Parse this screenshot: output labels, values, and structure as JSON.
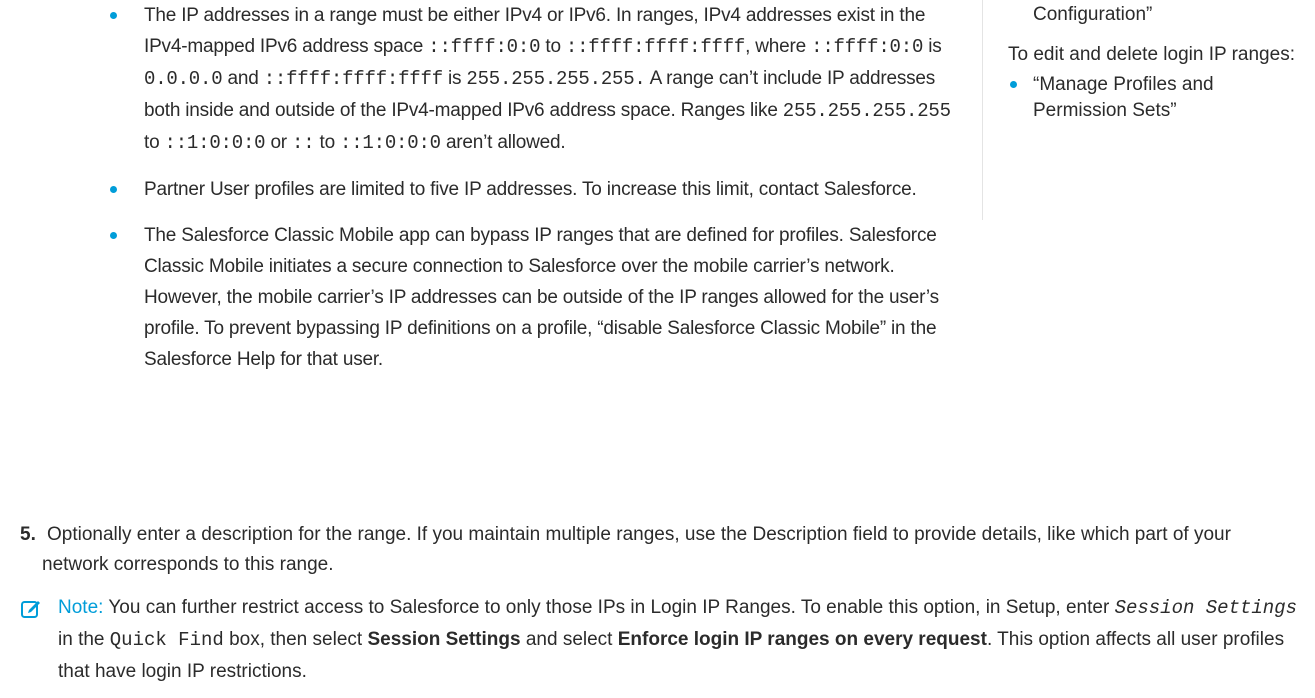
{
  "main_list": {
    "ip_family": {
      "t1": "The IP addresses in a range must be either IPv4 or IPv6. In ranges, IPv4 addresses exist in the IPv4-mapped IPv6 address space ",
      "c1": "::ffff:0:0",
      "t2": " to ",
      "c2": "::ffff:ffff:ffff",
      "t3": ", where ",
      "c3": "::ffff:0:0",
      "t4": " is ",
      "c4": "0.0.0.0",
      "t5": " and ",
      "c5": "::ffff:ffff:ffff",
      "t6": " is ",
      "c6": "255.255.255.255.",
      "t7": " A range can’t include IP addresses both inside and outside of the IPv4-mapped IPv6 address space. Ranges like ",
      "c7": "255.255.255.255",
      "t8": " to ",
      "c8": "::1:0:0:0",
      "t9": " or ",
      "c9": "::",
      "t10": " to ",
      "c10": "::1:0:0:0",
      "t11": " aren’t allowed."
    },
    "partner_limit": "Partner User profiles are limited to five IP addresses. To increase this limit, contact Salesforce.",
    "mobile_bypass": "The Salesforce Classic Mobile app can bypass IP ranges that are defined for profiles. Salesforce Classic Mobile initiates a secure connection to Salesforce over the mobile carrier’s network. However, the mobile carrier’s IP addresses can be outside of the IP ranges allowed for the user’s profile. To prevent bypassing IP definitions on a profile, “disable Salesforce Classic Mobile” in the Salesforce Help for that user."
  },
  "sidebar": {
    "config_line": "Configuration”",
    "edit_heading": "To edit and delete login IP ranges:",
    "permission": "“Manage Profiles and Permission Sets”"
  },
  "step5": {
    "number": "5.",
    "text": "Optionally enter a description for the range. If you maintain multiple ranges, use the Description field to provide details, like which part of your network corresponds to this range."
  },
  "note": {
    "lead": "Note:",
    "t1": " You can further restrict access to Salesforce to only those IPs in Login IP Ranges. To enable this option, in Setup, enter ",
    "code1": "Session Settings",
    "t2": " in the ",
    "code2": "Quick Find",
    "t3": " box, then select ",
    "b1": "Session Settings",
    "t4": " and select ",
    "b2": "Enforce login IP ranges on every request",
    "t5": ". This option affects all user profiles that have login IP restrictions."
  },
  "colors": {
    "accent": "#009dd9",
    "text": "#2b2b2b"
  },
  "icons": {
    "note": "note-edit-icon"
  }
}
